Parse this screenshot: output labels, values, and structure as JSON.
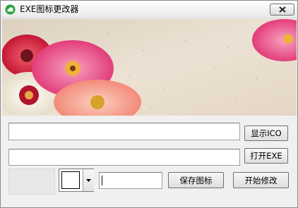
{
  "window": {
    "title": "EXE图标更改器",
    "icon": "green-cloud-app-icon",
    "close_icon": "close-icon"
  },
  "banner": {
    "description_icon": "flower-banner",
    "colors": {
      "background": "#e9dccb",
      "red": "#d81c3a",
      "pink": "#ec4d83",
      "peach": "#f6a48d",
      "white": "#f4efe6"
    }
  },
  "controls": {
    "ico_path": {
      "value": "",
      "placeholder": ""
    },
    "exe_path": {
      "value": "",
      "placeholder": ""
    },
    "show_ico_label": "显示ICO",
    "open_exe_label": "打开EXE",
    "color_select": {
      "selected_color": "#ffffff",
      "arrow_icon": "dropdown-arrow-icon"
    },
    "name_input": {
      "value": "",
      "placeholder": ""
    },
    "save_icon_label": "保存图标",
    "start_modify_label": "开始修改"
  }
}
